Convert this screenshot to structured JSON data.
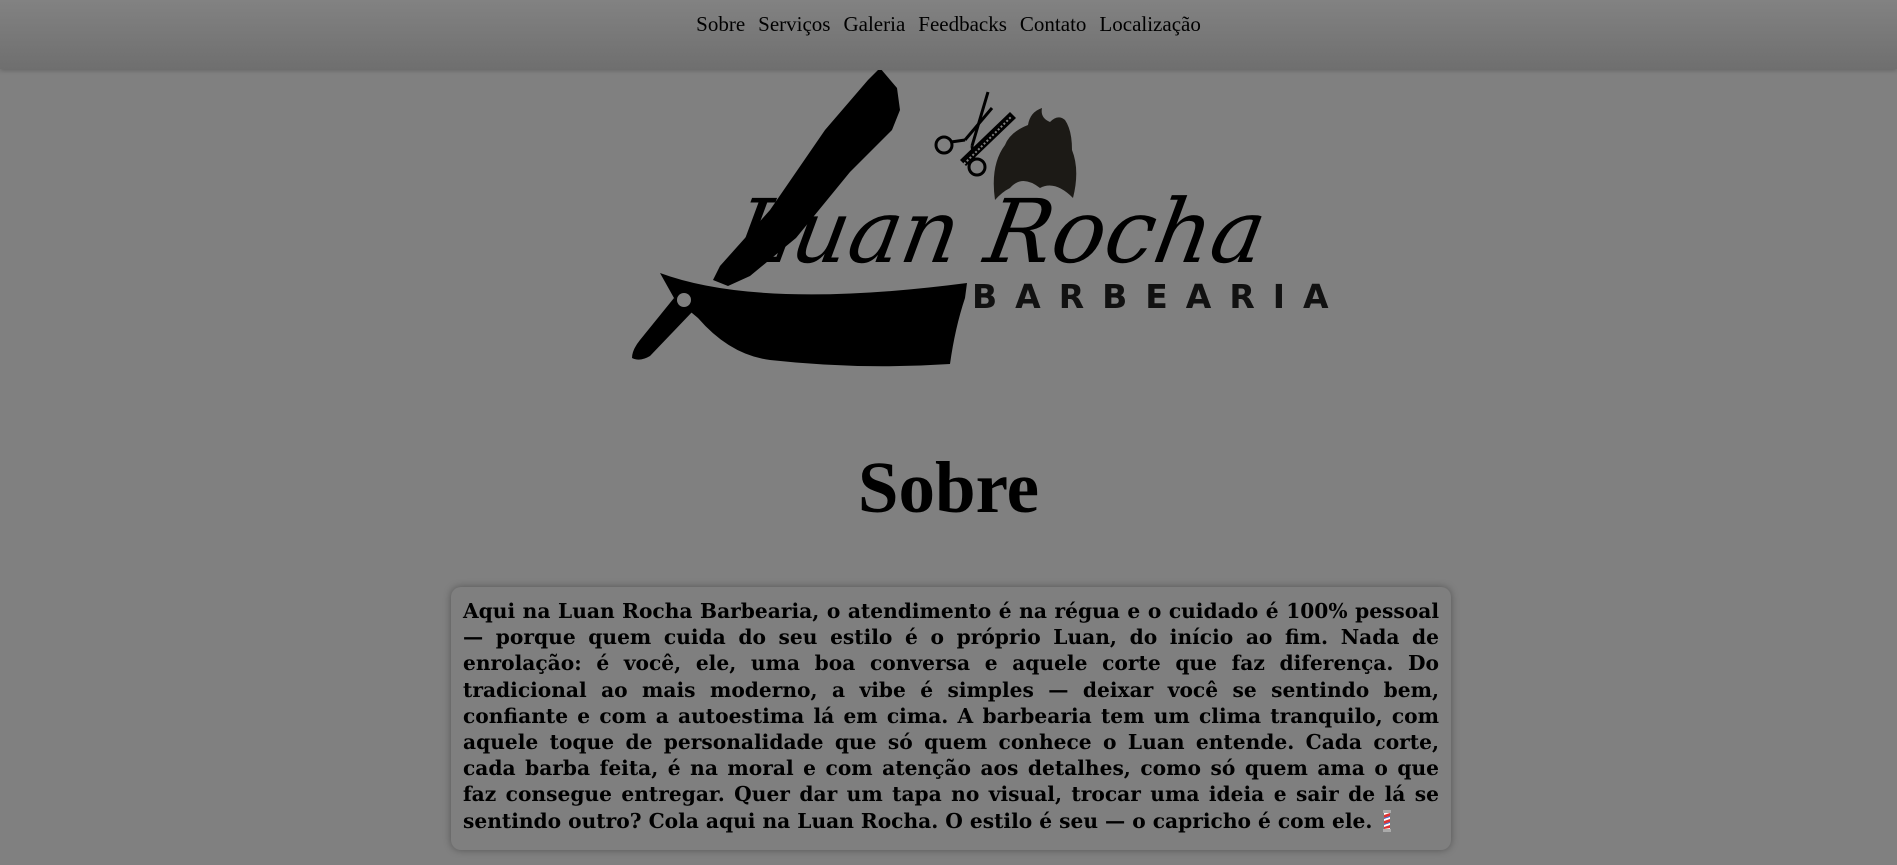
{
  "nav": {
    "items": [
      "Sobre",
      "Serviços",
      "Galeria",
      "Feedbacks",
      "Contato",
      "Localização"
    ]
  },
  "logo": {
    "name": "Luan Rocha",
    "subtitle": "BARBEARIA"
  },
  "section": {
    "title": "Sobre",
    "text": "Aqui na Luan Rocha Barbearia, o atendimento é na régua e o cuidado é 100% pessoal — porque quem cuida do seu estilo é o próprio Luan, do início ao fim. Nada de enrolação: é você, ele, uma boa conversa e aquele corte que faz diferença. Do tradicional ao mais moderno, a vibe é simples — deixar você se sentindo bem, confiante e com a autoestima lá em cima. A barbearia tem um clima tranquilo, com aquele toque de personalidade que só quem conhece o Luan entende. Cada corte, cada barba feita, é na moral e com atenção aos detalhes, como só quem ama o que faz consegue entregar. Quer dar um tapa no visual, trocar uma ideia e sair de lá se sentindo outro? Cola aqui na Luan Rocha. O estilo é seu — o capricho é com ele.",
    "end_icon": "barber-pole-icon"
  },
  "colors": {
    "background": "#808080",
    "topbar": "#777777",
    "text": "#000000"
  }
}
